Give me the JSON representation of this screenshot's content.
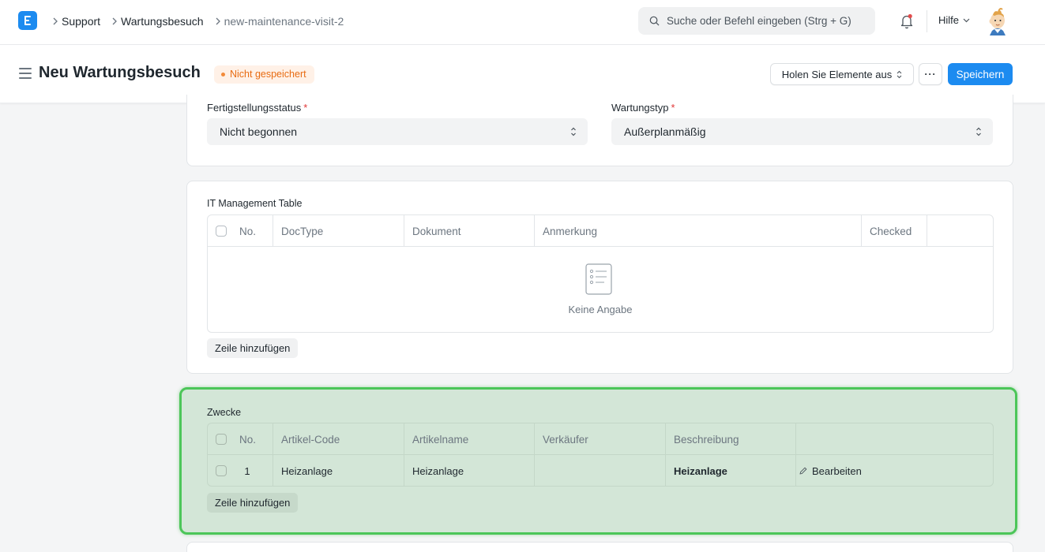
{
  "navbar": {
    "breadcrumbs": [
      "Support",
      "Wartungsbesuch",
      "new-maintenance-visit-2"
    ],
    "search_placeholder": "Suche oder Befehl eingeben (Strg + G)",
    "help_label": "Hilfe"
  },
  "page": {
    "title": "Neu Wartungsbesuch",
    "status_indicator": "Nicht gespeichert",
    "get_items_button": "Holen Sie Elemente aus",
    "more_button": "···",
    "save_button": "Speichern"
  },
  "status_section": {
    "completion_status_label": "Fertigstellungsstatus",
    "completion_status_value": "Nicht begonnen",
    "maintenance_type_label": "Wartungstyp",
    "maintenance_type_value": "Außerplanmäßig"
  },
  "it_management": {
    "label": "IT Management Table",
    "columns": [
      "No.",
      "DocType",
      "Dokument",
      "Anmerkung",
      "Checked"
    ],
    "empty_text": "Keine Angabe",
    "add_row": "Zeile hinzufügen"
  },
  "purposes": {
    "label": "Zwecke",
    "columns": [
      "No.",
      "Artikel-Code",
      "Artikelname",
      "Verkäufer",
      "Beschreibung"
    ],
    "rows": [
      {
        "no": "1",
        "item_code": "Heizanlage",
        "item_name": "Heizanlage",
        "sales_person": "",
        "description": "Heizanlage",
        "edit": "Bearbeiten"
      }
    ],
    "add_row": "Zeile hinzufügen"
  },
  "colors": {
    "primary": "#1c8bf0",
    "highlight_border": "#4cc659",
    "highlight_fill": "#d3e6d7",
    "indicator": "#e86c13"
  }
}
